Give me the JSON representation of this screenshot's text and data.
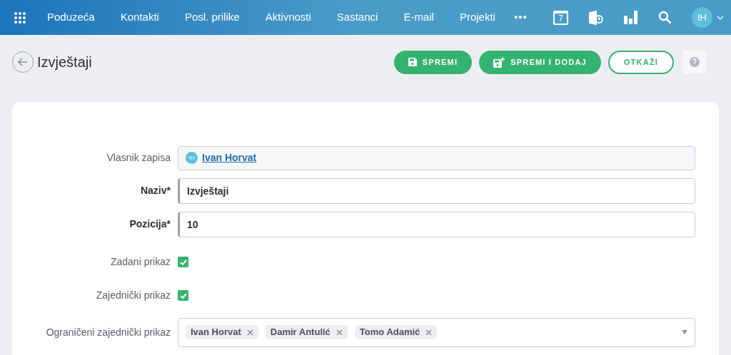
{
  "nav": {
    "items": [
      "Poduzeća",
      "Kontakti",
      "Posl. prilike",
      "Aktivnosti",
      "Sastanci",
      "E-mail",
      "Projekti"
    ],
    "more": "•••",
    "calendar_day": "7",
    "user_initials": "IH"
  },
  "help": "?",
  "header": {
    "title": "Izvještaji",
    "buttons": [
      {
        "kind": "save",
        "label": "SPREMI"
      },
      {
        "kind": "save_add",
        "label": "SPREMI I DODAJ"
      },
      {
        "kind": "cancel",
        "label": "OTKAŽI"
      }
    ]
  },
  "form": {
    "fields": [
      {
        "kind": "owner",
        "label": "Vlasnik zapisa",
        "required": false,
        "initials": "IH",
        "value": "Ivan Horvat"
      },
      {
        "kind": "text",
        "label": "Naziv*",
        "required": true,
        "value": "Izvještaji"
      },
      {
        "kind": "text",
        "label": "Pozicija*",
        "required": true,
        "value": "10"
      },
      {
        "kind": "checkbox",
        "label": "Zadani prikaz",
        "required": false,
        "checked": true
      },
      {
        "kind": "checkbox",
        "label": "Zajednički prikaz",
        "required": false,
        "checked": true
      },
      {
        "kind": "tags",
        "label": "Ograničeni zajednički prikaz",
        "required": false,
        "tags": [
          "Ivan Horvat",
          "Damir Antulić",
          "Tomo Adamić"
        ]
      }
    ]
  }
}
